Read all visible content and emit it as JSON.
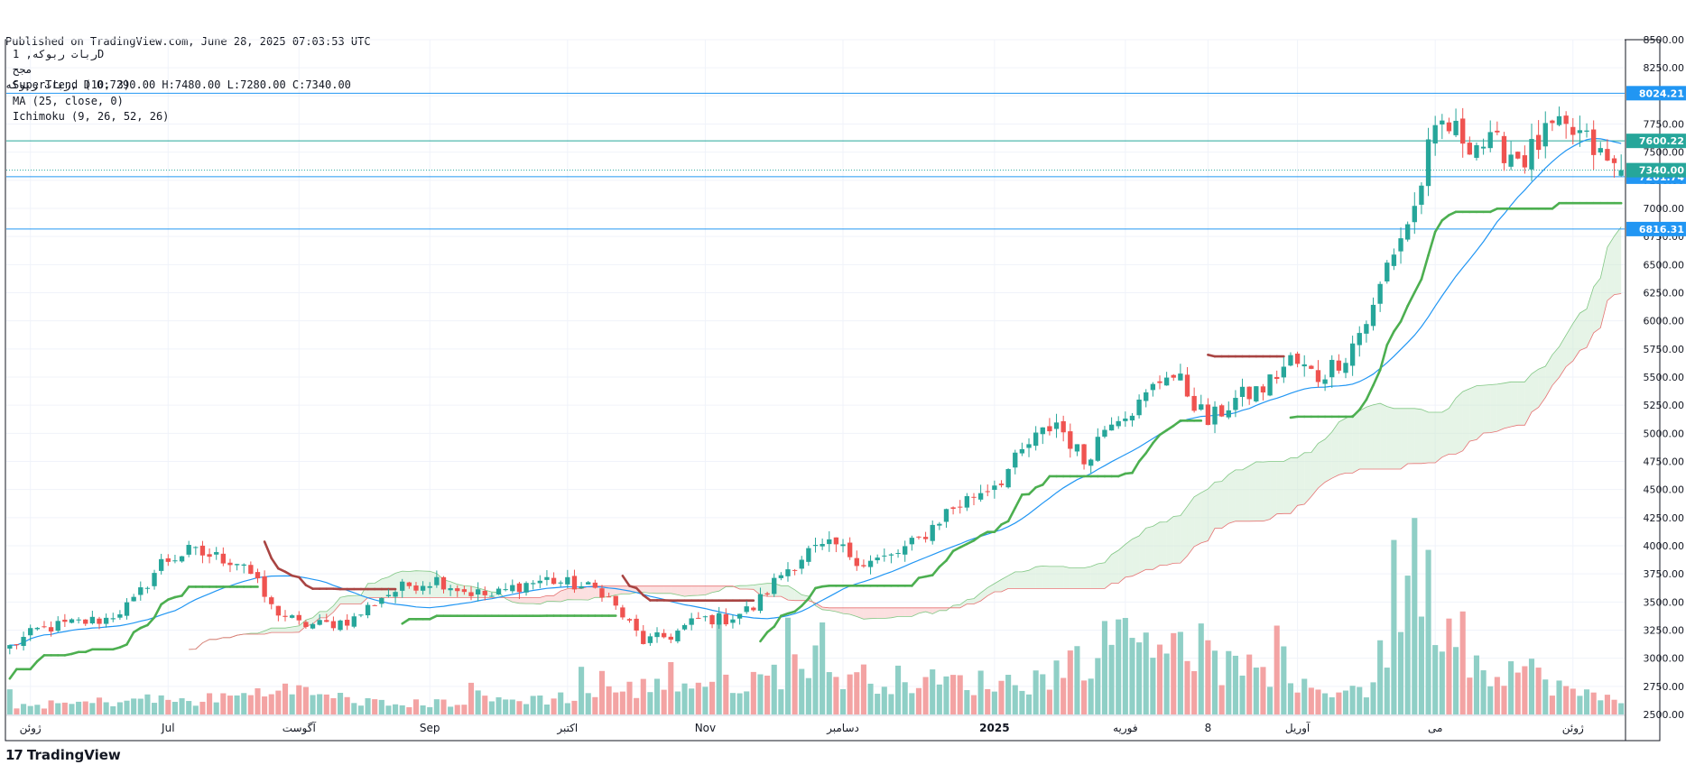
{
  "header": {
    "published": "Published on TradingView.com, June 28, 2025 07:03:53 UTC",
    "ohlc": "ربات ربوکه, D O:7290.00 H:7480.00 L:7280.00 C:7340.00"
  },
  "legend": {
    "symbol": "ربات ربوکه, 1D",
    "sub": "مجح",
    "supertrend": "SuperTrend (10, 3)",
    "ma": "MA (25, close, 0)",
    "ichimoku": "Ichimoku (9, 26, 52, 26)"
  },
  "footer": {
    "brand": "TradingView",
    "logo_icon": "tradingview-logo-icon"
  },
  "colors": {
    "up": "#26a69a",
    "down": "#ef5350",
    "vol_up": "#8fcfc6",
    "vol_down": "#f3a3a3",
    "supertrend_up": "#4caf50",
    "supertrend_down": "#a94442",
    "ma": "#2196f3",
    "cloud_up": "#c8e6c9",
    "cloud_down": "#f8bbbb",
    "hline": "#2196f3",
    "hline_teal": "#26a69a"
  },
  "chart_data": {
    "type": "candlestick",
    "interval": "1D",
    "y_axis": {
      "min": 2500,
      "max": 8500,
      "ticks": [
        "2500.00",
        "2750.00",
        "3000.00",
        "3250.00",
        "3500.00",
        "3750.00",
        "4000.00",
        "4250.00",
        "4500.00",
        "4750.00",
        "5000.00",
        "5250.00",
        "5500.00",
        "5750.00",
        "6000.00",
        "6250.00",
        "6500.00",
        "6750.00",
        "7000.00",
        "7250.00",
        "7500.00",
        "7750.00",
        "8000.00",
        "8250.00",
        "8500.00"
      ]
    },
    "x_axis": {
      "labels": [
        {
          "text": "ژوئن",
          "i": 3
        },
        {
          "text": "Jul",
          "i": 23
        },
        {
          "text": "آگوست",
          "i": 42
        },
        {
          "text": "Sep",
          "i": 61
        },
        {
          "text": "اکتبر",
          "i": 81
        },
        {
          "text": "Nov",
          "i": 101
        },
        {
          "text": "دسامبر",
          "i": 121
        },
        {
          "text": "2025",
          "i": 143,
          "bold": true
        },
        {
          "text": "فوریه",
          "i": 162
        },
        {
          "text": "8",
          "i": 174
        },
        {
          "text": "آوریل",
          "i": 187
        },
        {
          "text": "می",
          "i": 207
        },
        {
          "text": "ژوئن",
          "i": 227
        }
      ]
    },
    "price_levels": [
      {
        "value": 8024.21,
        "label": "8024.21",
        "color": "#2196f3"
      },
      {
        "value": 7600.22,
        "label": "7600.22",
        "color": "#26a69a"
      },
      {
        "value": 7281.74,
        "label": "7281.74",
        "color": "#2196f3"
      },
      {
        "value": 6816.31,
        "label": "6816.31",
        "color": "#2196f3"
      }
    ],
    "last_price": {
      "value": 7340,
      "label": "7340.00",
      "color": "#26a69a"
    },
    "key_points": [
      [
        0,
        3100
      ],
      [
        4,
        3250
      ],
      [
        8,
        3300
      ],
      [
        14,
        3350
      ],
      [
        18,
        3500
      ],
      [
        22,
        3850
      ],
      [
        26,
        3950
      ],
      [
        30,
        3900
      ],
      [
        34,
        3850
      ],
      [
        38,
        3450
      ],
      [
        42,
        3300
      ],
      [
        46,
        3300
      ],
      [
        50,
        3350
      ],
      [
        54,
        3550
      ],
      [
        58,
        3650
      ],
      [
        62,
        3700
      ],
      [
        66,
        3600
      ],
      [
        70,
        3550
      ],
      [
        74,
        3650
      ],
      [
        78,
        3700
      ],
      [
        82,
        3650
      ],
      [
        86,
        3600
      ],
      [
        88,
        3450
      ],
      [
        92,
        3150
      ],
      [
        96,
        3200
      ],
      [
        100,
        3350
      ],
      [
        104,
        3350
      ],
      [
        108,
        3450
      ],
      [
        112,
        3750
      ],
      [
        116,
        3950
      ],
      [
        120,
        4000
      ],
      [
        124,
        3850
      ],
      [
        128,
        3900
      ],
      [
        132,
        4050
      ],
      [
        136,
        4300
      ],
      [
        140,
        4450
      ],
      [
        144,
        4600
      ],
      [
        148,
        4900
      ],
      [
        152,
        5100
      ],
      [
        156,
        4750
      ],
      [
        160,
        5150
      ],
      [
        164,
        5250
      ],
      [
        168,
        5550
      ],
      [
        170,
        5450
      ],
      [
        174,
        5100
      ],
      [
        178,
        5300
      ],
      [
        182,
        5400
      ],
      [
        186,
        5650
      ],
      [
        190,
        5500
      ],
      [
        194,
        5700
      ],
      [
        198,
        6100
      ],
      [
        200,
        6500
      ],
      [
        204,
        7000
      ],
      [
        206,
        7500
      ],
      [
        208,
        7750
      ],
      [
        212,
        7600
      ],
      [
        216,
        7550
      ],
      [
        220,
        7450
      ],
      [
        224,
        7700
      ],
      [
        228,
        7650
      ],
      [
        232,
        7400
      ],
      [
        234,
        7340
      ]
    ],
    "volume": {
      "ylim": [
        0,
        40
      ],
      "key_points": [
        [
          0,
          1.4
        ],
        [
          8,
          1.6
        ],
        [
          20,
          2.4
        ],
        [
          26,
          2.0
        ],
        [
          40,
          3.8
        ],
        [
          55,
          1.5
        ],
        [
          80,
          2.6
        ],
        [
          95,
          4.5
        ],
        [
          110,
          5.5
        ],
        [
          118,
          10.5
        ],
        [
          120,
          6.0
        ],
        [
          135,
          5.0
        ],
        [
          148,
          5.0
        ],
        [
          160,
          11.0
        ],
        [
          170,
          13.0
        ],
        [
          175,
          8.0
        ],
        [
          185,
          4.0
        ],
        [
          197,
          4.0
        ],
        [
          205,
          21.0
        ],
        [
          212,
          8.0
        ],
        [
          220,
          7.0
        ],
        [
          228,
          3.0
        ],
        [
          234,
          2.3
        ]
      ]
    }
  }
}
